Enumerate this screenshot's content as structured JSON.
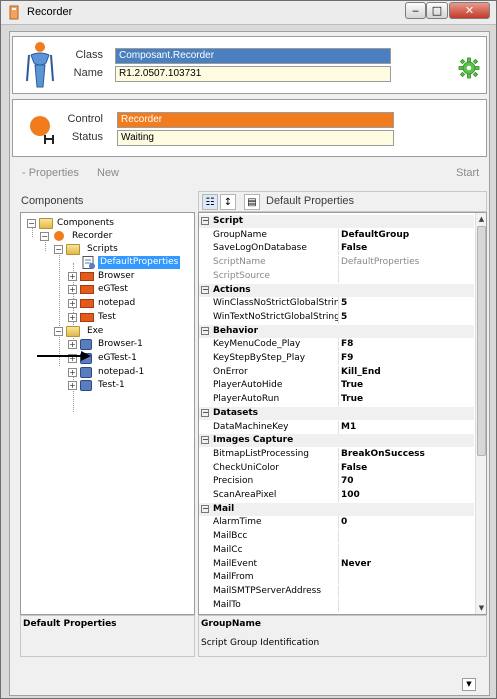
{
  "window": {
    "title": "Recorder",
    "min": "‒",
    "max": "□",
    "close": "✕"
  },
  "header": {
    "class_label": "Class",
    "class_value": "Composant.Recorder",
    "name_label": "Name",
    "name_value": "R1.2.0507.103731"
  },
  "control": {
    "control_label": "Control",
    "control_value": "Recorder",
    "status_label": "Status",
    "status_value": "Waiting"
  },
  "toolbar": {
    "properties": "- Properties",
    "new": "New",
    "start": "Start"
  },
  "components": {
    "title": "Components",
    "tree": [
      {
        "label": "Components",
        "expander": "−"
      },
      {
        "label": "Recorder",
        "expander": "−"
      },
      {
        "label": "Scripts",
        "expander": "−"
      },
      {
        "label": "DefaultProperties"
      },
      {
        "label": "Browser",
        "expander": "+"
      },
      {
        "label": "eGTest",
        "expander": "+"
      },
      {
        "label": "notepad",
        "expander": "+"
      },
      {
        "label": "Test",
        "expander": "+"
      },
      {
        "label": "Exe",
        "expander": "−"
      },
      {
        "label": "Browser-1",
        "expander": "+"
      },
      {
        "label": "eGTest-1",
        "expander": "+"
      },
      {
        "label": "notepad-1",
        "expander": "+"
      },
      {
        "label": "Test-1",
        "expander": "+"
      }
    ],
    "desc_title": "Default Properties"
  },
  "propgrid": {
    "title": "Default Properties",
    "categorized_icon": "categorized-icon",
    "alpha_icon": "sort-alpha-icon",
    "pages_icon": "property-pages-icon",
    "rows": [
      {
        "cat": "Script"
      },
      {
        "k": "GroupName",
        "v": "DefaultGroup"
      },
      {
        "k": "SaveLogOnDatabase",
        "v": "False"
      },
      {
        "k": "ScriptName",
        "v": "DefaultProperties",
        "dis": true
      },
      {
        "k": "ScriptSource",
        "v": "",
        "dis": true
      },
      {
        "cat": "Actions"
      },
      {
        "k": "WinClassNoStrictGlobalStrin",
        "v": "5"
      },
      {
        "k": "WinTextNoStrictGlobalString",
        "v": "5"
      },
      {
        "cat": "Behavior"
      },
      {
        "k": "KeyMenuCode_Play",
        "v": "F8"
      },
      {
        "k": "KeyStepByStep_Play",
        "v": "F9"
      },
      {
        "k": "OnError",
        "v": "Kill_End"
      },
      {
        "k": "PlayerAutoHide",
        "v": "True"
      },
      {
        "k": "PlayerAutoRun",
        "v": "True"
      },
      {
        "cat": "Datasets"
      },
      {
        "k": "DataMachineKey",
        "v": "M1"
      },
      {
        "cat": "Images Capture"
      },
      {
        "k": "BitmapListProcessing",
        "v": "BreakOnSuccess"
      },
      {
        "k": "CheckUniColor",
        "v": "False"
      },
      {
        "k": "Precision",
        "v": "70"
      },
      {
        "k": "ScanAreaPixel",
        "v": "100"
      },
      {
        "cat": "Mail"
      },
      {
        "k": "AlarmTime",
        "v": "0"
      },
      {
        "k": "MailBcc",
        "v": ""
      },
      {
        "k": "MailCc",
        "v": ""
      },
      {
        "k": "MailEvent",
        "v": "Never"
      },
      {
        "k": "MailFrom",
        "v": ""
      },
      {
        "k": "MailSMTPServerAddress",
        "v": ""
      },
      {
        "k": "MailTo",
        "v": ""
      }
    ],
    "desc_title": "GroupName",
    "desc_text": "Script Group Identification"
  }
}
